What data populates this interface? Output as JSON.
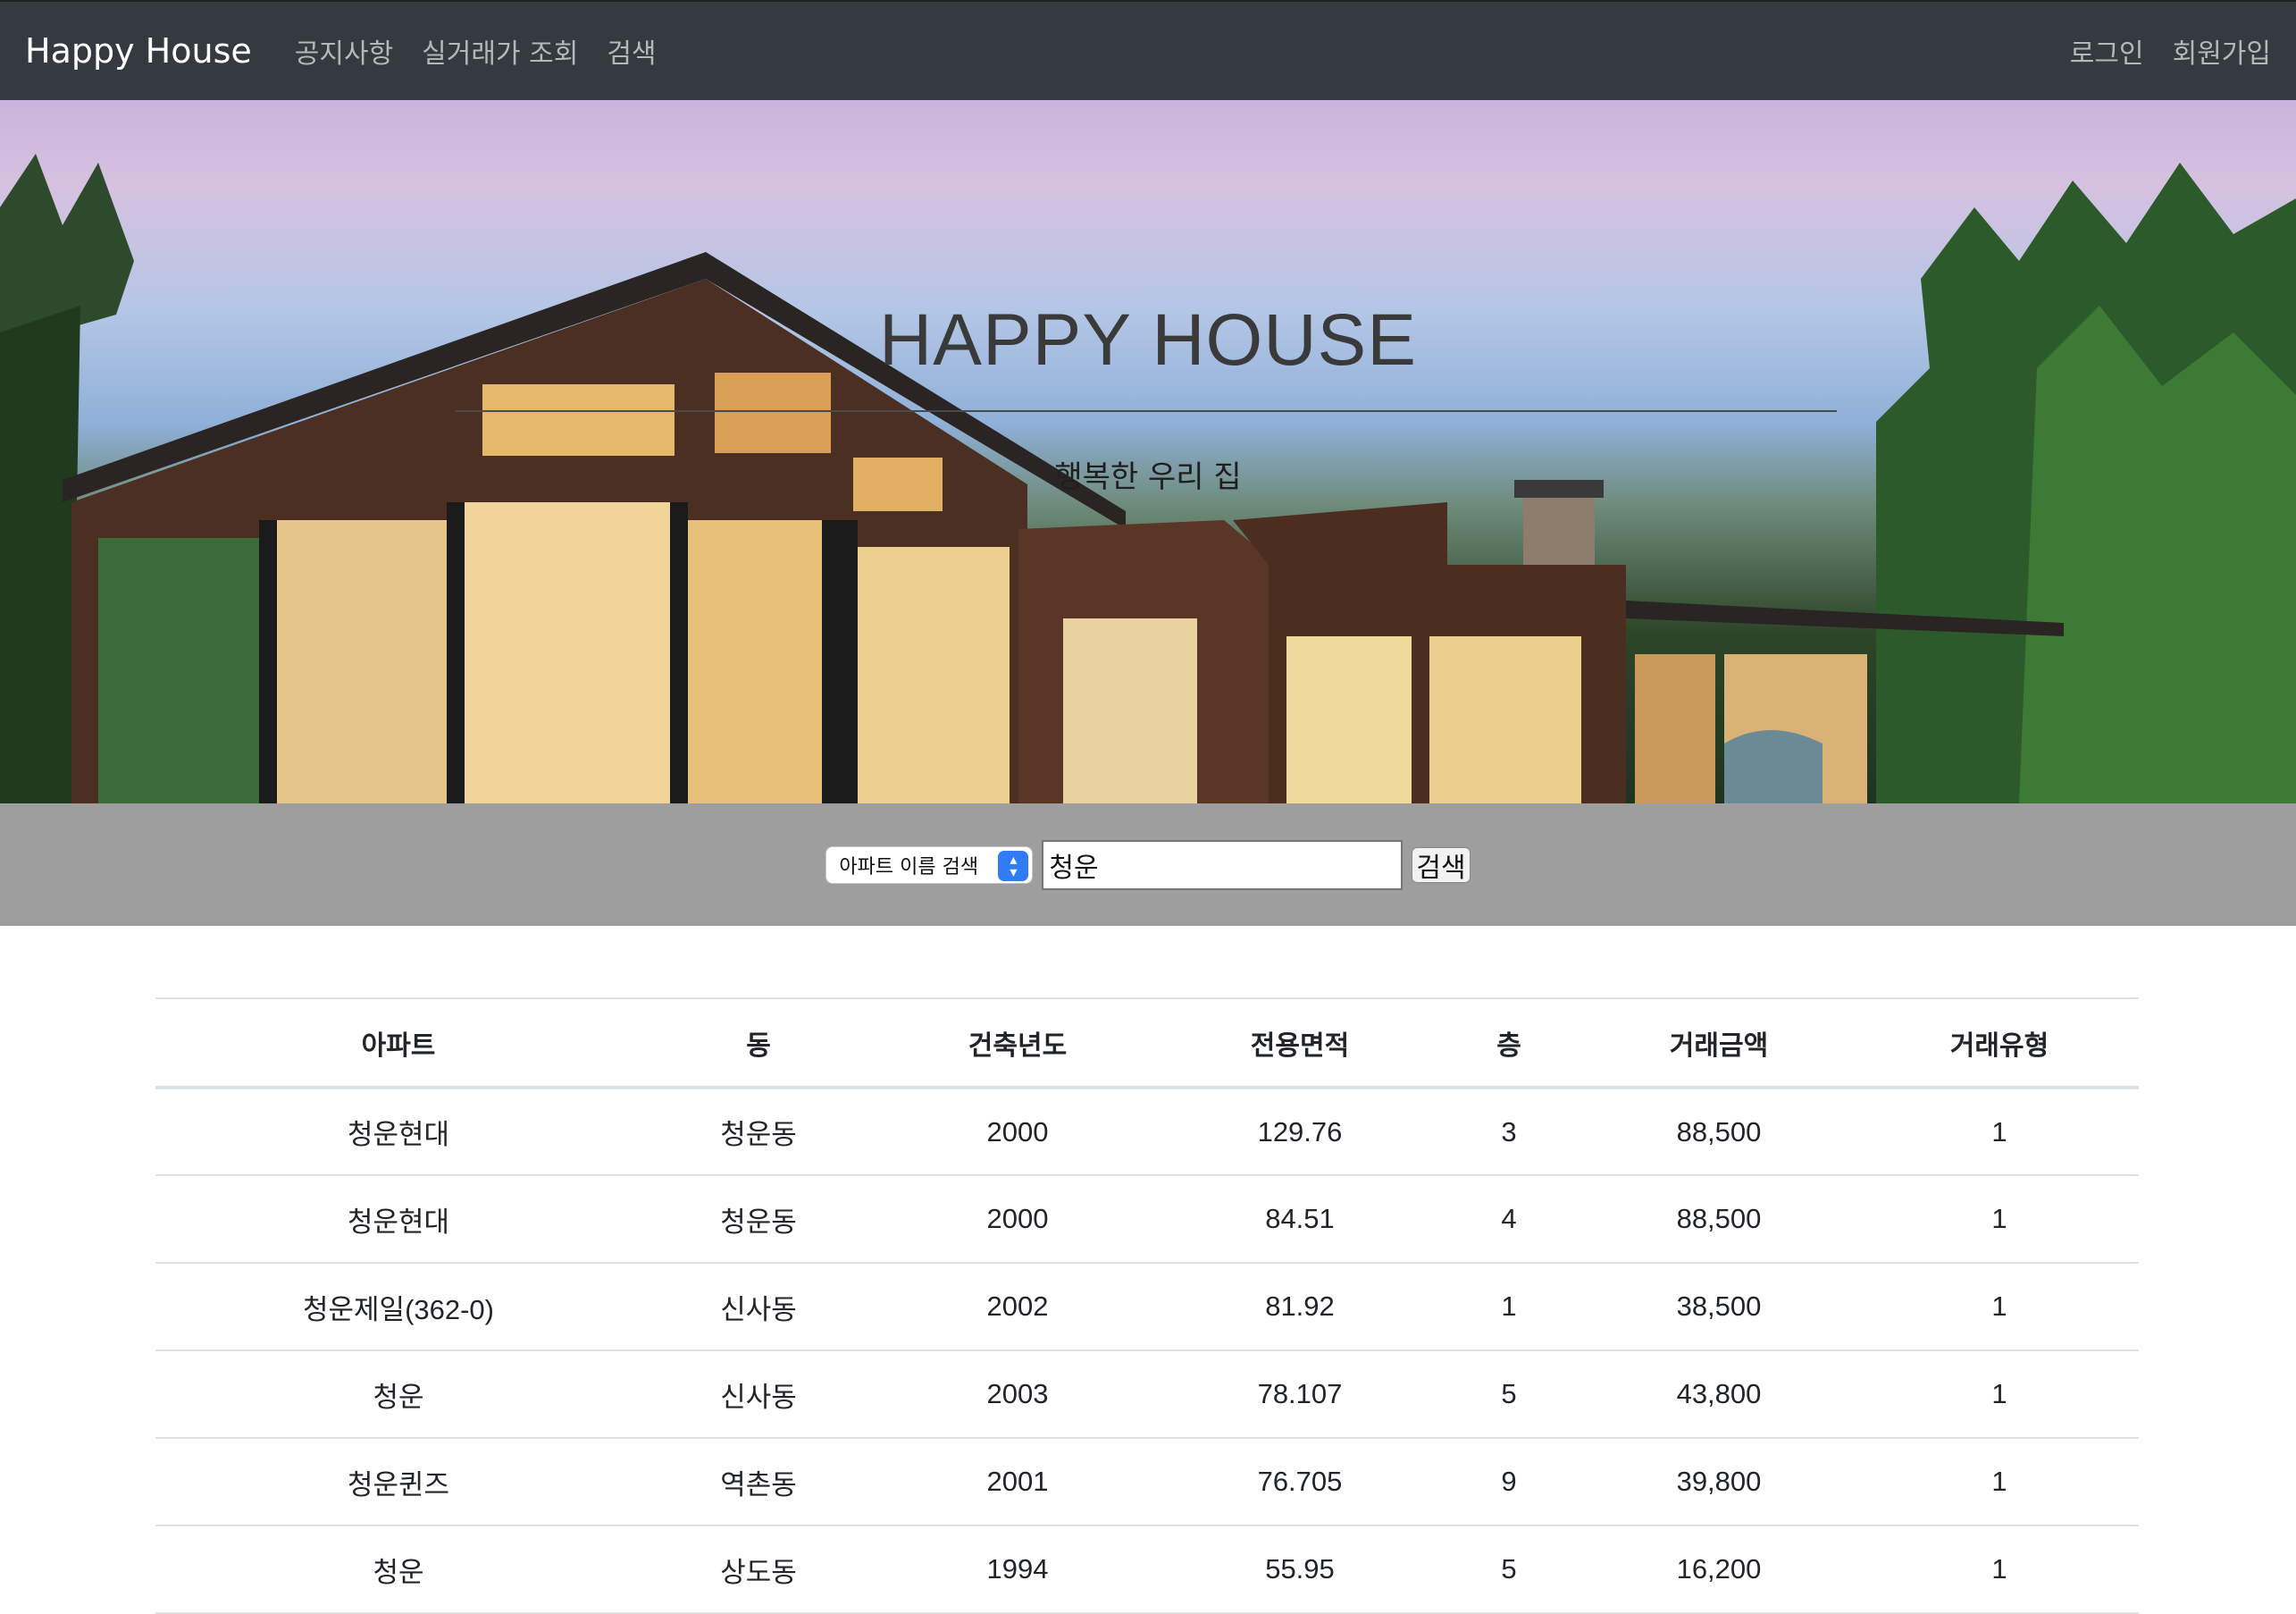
{
  "navbar": {
    "brand": "Happy House",
    "links": [
      "공지사항",
      "실거래가 조회",
      "검색"
    ],
    "right_links": [
      "로그인",
      "회원가입"
    ]
  },
  "hero": {
    "title": "HAPPY HOUSE",
    "subtitle": "행복한 우리 집"
  },
  "search": {
    "select_value": "아파트 이름 검색",
    "input_value": "청운",
    "button_label": "검색"
  },
  "table": {
    "headers": [
      "아파트",
      "동",
      "건축년도",
      "전용면적",
      "층",
      "거래금액",
      "거래유형"
    ],
    "rows": [
      [
        "청운현대",
        "청운동",
        "2000",
        "129.76",
        "3",
        "88,500",
        "1"
      ],
      [
        "청운현대",
        "청운동",
        "2000",
        "84.51",
        "4",
        "88,500",
        "1"
      ],
      [
        "청운제일(362-0)",
        "신사동",
        "2002",
        "81.92",
        "1",
        "38,500",
        "1"
      ],
      [
        "청운",
        "신사동",
        "2003",
        "78.107",
        "5",
        "43,800",
        "1"
      ],
      [
        "청운퀸즈",
        "역촌동",
        "2001",
        "76.705",
        "9",
        "39,800",
        "1"
      ],
      [
        "청운",
        "상도동",
        "1994",
        "55.95",
        "5",
        "16,200",
        "1"
      ]
    ]
  },
  "colors": {
    "navbar_bg": "#343a40",
    "search_bar_bg": "#9e9e9e",
    "select_accent": "#2f7cf6"
  }
}
